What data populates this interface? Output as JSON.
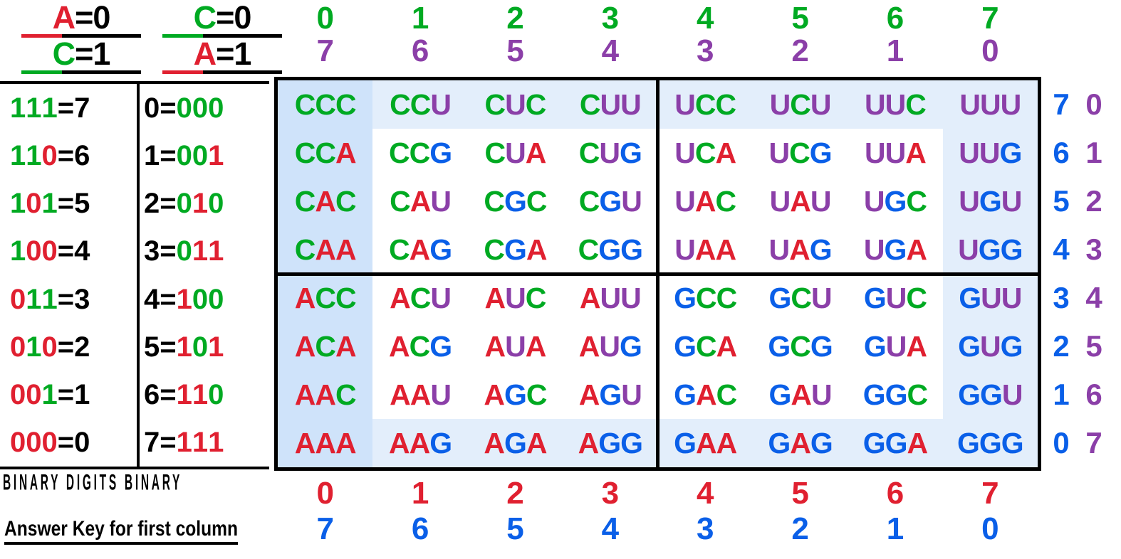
{
  "keys": [
    {
      "name": "key-left",
      "num": {
        "text": "A=0",
        "sym": "A",
        "sym_color": "red",
        "rest": "=0"
      },
      "den": {
        "text": "C=1",
        "sym": "C",
        "sym_color": "green",
        "rest": "=1"
      }
    },
    {
      "name": "key-right",
      "num": {
        "text": "C=0",
        "sym": "C",
        "sym_color": "green",
        "rest": "=0"
      },
      "den": {
        "text": "A=1",
        "sym": "A",
        "sym_color": "red",
        "rest": "=1"
      }
    }
  ],
  "legend": {
    "left_column": [
      {
        "bits": "111",
        "colors": [
          "green",
          "green",
          "green"
        ],
        "eq": "=7"
      },
      {
        "bits": "110",
        "colors": [
          "green",
          "green",
          "red"
        ],
        "eq": "=6"
      },
      {
        "bits": "101",
        "colors": [
          "green",
          "red",
          "green"
        ],
        "eq": "=5"
      },
      {
        "bits": "100",
        "colors": [
          "green",
          "red",
          "red"
        ],
        "eq": "=4"
      },
      {
        "bits": "011",
        "colors": [
          "red",
          "green",
          "green"
        ],
        "eq": "=3"
      },
      {
        "bits": "010",
        "colors": [
          "red",
          "green",
          "red"
        ],
        "eq": "=2"
      },
      {
        "bits": "001",
        "colors": [
          "red",
          "red",
          "green"
        ],
        "eq": "=1"
      },
      {
        "bits": "000",
        "colors": [
          "red",
          "red",
          "red"
        ],
        "eq": "=0"
      }
    ],
    "right_column": [
      {
        "dec": "0=",
        "bits": "000",
        "colors": [
          "green",
          "green",
          "green"
        ]
      },
      {
        "dec": "1=",
        "bits": "001",
        "colors": [
          "green",
          "green",
          "red"
        ]
      },
      {
        "dec": "2=",
        "bits": "010",
        "colors": [
          "green",
          "red",
          "green"
        ]
      },
      {
        "dec": "3=",
        "bits": "011",
        "colors": [
          "green",
          "red",
          "red"
        ]
      },
      {
        "dec": "4=",
        "bits": "100",
        "colors": [
          "red",
          "green",
          "green"
        ]
      },
      {
        "dec": "5=",
        "bits": "101",
        "colors": [
          "red",
          "green",
          "red"
        ]
      },
      {
        "dec": "6=",
        "bits": "110",
        "colors": [
          "red",
          "red",
          "green"
        ]
      },
      {
        "dec": "7=",
        "bits": "111",
        "colors": [
          "red",
          "red",
          "red"
        ]
      }
    ]
  },
  "captions": {
    "binary_digits": "BINARY  DIGITS  BINARY",
    "answer_key": "Answer Key for first column"
  },
  "headers": {
    "top_primary": {
      "color": "green",
      "values": [
        "0",
        "1",
        "2",
        "3",
        "4",
        "5",
        "6",
        "7"
      ]
    },
    "top_secondary": {
      "color": "purple",
      "values": [
        "7",
        "6",
        "5",
        "4",
        "3",
        "2",
        "1",
        "0"
      ]
    },
    "bottom_primary": {
      "color": "red",
      "values": [
        "0",
        "1",
        "2",
        "3",
        "4",
        "5",
        "6",
        "7"
      ]
    },
    "bottom_secondary": {
      "color": "blue",
      "values": [
        "7",
        "6",
        "5",
        "4",
        "3",
        "2",
        "1",
        "0"
      ]
    },
    "right_primary": {
      "color": "blue",
      "values": [
        "7",
        "6",
        "5",
        "4",
        "3",
        "2",
        "1",
        "0"
      ]
    },
    "right_secondary": {
      "color": "purple",
      "values": [
        "0",
        "1",
        "2",
        "3",
        "4",
        "5",
        "6",
        "7"
      ]
    }
  },
  "nucleotide_colors": {
    "C": "#00aa22",
    "A": "#e02030",
    "U": "#8b3fa8",
    "G": "#0a5fe8"
  },
  "palette": {
    "green": "#00aa22",
    "red": "#e02030",
    "purple": "#8b3fa8",
    "blue": "#0a5fe8",
    "shade_column": "#cfe3fa",
    "shade_row": "#e3eefb"
  },
  "grid": {
    "rows": [
      [
        "CCC",
        "CCU",
        "CUC",
        "CUU",
        "UCC",
        "UCU",
        "UUC",
        "UUU"
      ],
      [
        "CCA",
        "CCG",
        "CUA",
        "CUG",
        "UCA",
        "UCG",
        "UUA",
        "UUG"
      ],
      [
        "CAC",
        "CAU",
        "CGC",
        "CGU",
        "UAC",
        "UAU",
        "UGC",
        "UGU"
      ],
      [
        "CAA",
        "CAG",
        "CGA",
        "CGG",
        "UAA",
        "UAG",
        "UGA",
        "UGG"
      ],
      [
        "ACC",
        "ACU",
        "AUC",
        "AUU",
        "GCC",
        "GCU",
        "GUC",
        "GUU"
      ],
      [
        "ACA",
        "ACG",
        "AUA",
        "AUG",
        "GCA",
        "GCG",
        "GUA",
        "GUG"
      ],
      [
        "AAC",
        "AAU",
        "AGC",
        "AGU",
        "GAC",
        "GAU",
        "GGC",
        "GGU"
      ],
      [
        "AAA",
        "AAG",
        "AGA",
        "AGG",
        "GAA",
        "GAG",
        "GGA",
        "GGG"
      ]
    ]
  }
}
